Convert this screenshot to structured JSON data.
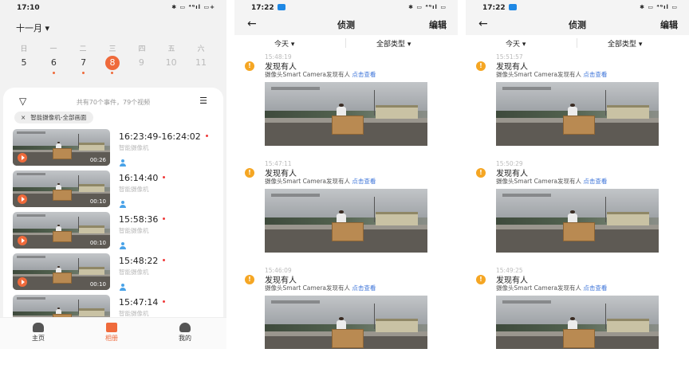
{
  "phone1": {
    "status": {
      "time": "17:10",
      "icons": "✱ ▭ ⁴ᴳıl ▭+"
    },
    "calendar": {
      "month": "十一月",
      "weekdays": [
        "日",
        "一",
        "二",
        "三",
        "四",
        "五",
        "六"
      ],
      "dates": [
        {
          "d": "5",
          "dot": false,
          "dim": false,
          "sel": false
        },
        {
          "d": "6",
          "dot": true,
          "dim": false,
          "sel": false
        },
        {
          "d": "7",
          "dot": true,
          "dim": false,
          "sel": false
        },
        {
          "d": "8",
          "dot": true,
          "dim": false,
          "sel": true
        },
        {
          "d": "9",
          "dot": false,
          "dim": true,
          "sel": false
        },
        {
          "d": "10",
          "dot": false,
          "dim": true,
          "sel": false
        },
        {
          "d": "11",
          "dot": false,
          "dim": true,
          "sel": false
        }
      ]
    },
    "summary": "共有70个事件，79个视频",
    "chip": {
      "close": "×",
      "label": "智能摄像机-全部画面"
    },
    "events": [
      {
        "time": "16:23:49-16:24:02",
        "source": "智能摄像机",
        "duration": "00:26",
        "person": true
      },
      {
        "time": "16:14:40",
        "source": "智能摄像机",
        "duration": "00:10",
        "person": true
      },
      {
        "time": "15:58:36",
        "source": "智能摄像机",
        "duration": "00:10",
        "person": true
      },
      {
        "time": "15:48:22",
        "source": "智能摄像机",
        "duration": "00:10",
        "person": true
      },
      {
        "time": "15:47:14",
        "source": "智能摄像机",
        "duration": "",
        "person": false
      }
    ],
    "tabs": [
      {
        "label": "主页",
        "icon": "home-icon",
        "active": false
      },
      {
        "label": "相册",
        "icon": "album-icon",
        "active": true
      },
      {
        "label": "我的",
        "icon": "profile-icon",
        "active": false
      }
    ]
  },
  "phone2": {
    "status": {
      "time": "17:22",
      "icons": "✱ ▭ ⁴ᴳıl ▭"
    },
    "header": {
      "back": "←",
      "title": "侦测",
      "edit": "编辑"
    },
    "filters": {
      "date": "今天",
      "type": "全部类型",
      "arrow": "▾"
    },
    "items": [
      {
        "ts": "15:48:19",
        "title": "发现有人",
        "desc": "摄像头Smart Camera发现有人",
        "link": "点击查看"
      },
      {
        "ts": "15:47:11",
        "title": "发现有人",
        "desc": "摄像头Smart Camera发现有人",
        "link": "点击查看"
      },
      {
        "ts": "15:46:09",
        "title": "发现有人",
        "desc": "摄像头Smart Camera发现有人",
        "link": "点击查看"
      }
    ]
  },
  "phone3": {
    "status": {
      "time": "17:22",
      "icons": "✱ ▭ ⁴ᴳıl ▭"
    },
    "header": {
      "back": "←",
      "title": "侦测",
      "edit": "编辑"
    },
    "filters": {
      "date": "今天",
      "type": "全部类型",
      "arrow": "▾"
    },
    "items": [
      {
        "ts": "15:51:57",
        "title": "发现有人",
        "desc": "摄像头Smart Camera发现有人",
        "link": "点击查看"
      },
      {
        "ts": "15:50:29",
        "title": "发现有人",
        "desc": "摄像头Smart Camera发现有人",
        "link": "点击查看"
      },
      {
        "ts": "15:49:25",
        "title": "发现有人",
        "desc": "摄像头Smart Camera发现有人",
        "link": "点击查看"
      }
    ]
  },
  "colors": {
    "accent": "#ef6a3b",
    "link": "#3b73d9",
    "badge": "#f5a623",
    "person": "#4aa3e8"
  }
}
